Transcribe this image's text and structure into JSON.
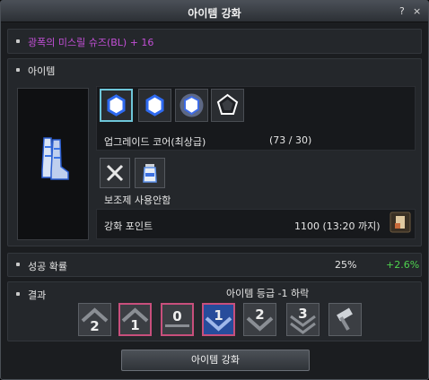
{
  "window": {
    "title": "아이템 강화",
    "help_label": "?",
    "close_label": "×"
  },
  "target_item": {
    "name": "광폭의 미스릴 슈즈(BL) + 16"
  },
  "item_section": {
    "title": "아이템",
    "core_label": "업그레이드 코어(최상급)",
    "core_count": "(73 / 30)",
    "aux_label": "보조제 사용안함",
    "points_label": "강화 포인트",
    "points_value": "1100 (13:20 까지)"
  },
  "success": {
    "label": "성공 확률",
    "rate": "25%",
    "bonus": "+2.6%"
  },
  "result": {
    "label": "결과",
    "note": "아이템 등급 -1 하락",
    "grades": [
      "2",
      "1",
      "0",
      "1",
      "2",
      "3"
    ]
  },
  "actions": {
    "enchant_label": "아이템 강화"
  },
  "colors": {
    "item_name": "#c24fd6",
    "bonus": "#4ed24e",
    "selected_border": "#6ec6d9",
    "highlight_border": "#c84f7c",
    "current_grade": "#274c9b"
  }
}
